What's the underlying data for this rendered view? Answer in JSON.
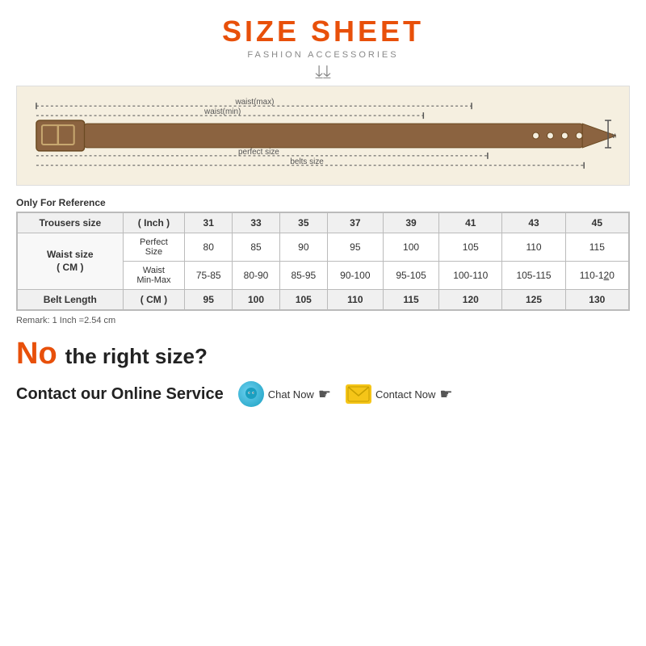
{
  "header": {
    "title": "SIZE SHEET",
    "subtitle": "FASHION ACCESSORIES",
    "chevron": "❯❯"
  },
  "belt_diagram": {
    "labels": {
      "waist_max": "waist(max)",
      "waist_min": "waist(min)",
      "perfect_size": "perfect size",
      "belts_size": "belts size",
      "width": "width"
    }
  },
  "only_ref": "Only For Reference",
  "table": {
    "col_headers": [
      "",
      "( Inch )",
      "31",
      "33",
      "35",
      "37",
      "39",
      "41",
      "43",
      "45"
    ],
    "waist_size_label": "Waist size\n( CM )",
    "perfect_size_label": "Perfect\nSize",
    "waist_min_max_label": "Waist\nMin-Max",
    "trousers_size_label": "Trousers size",
    "perfect_size_values": [
      "80",
      "85",
      "90",
      "95",
      "100",
      "105",
      "110",
      "115"
    ],
    "waist_min_max_values": [
      "75-85",
      "80-90",
      "85-95",
      "90-100",
      "95-105",
      "100-110",
      "105-115",
      "110-120"
    ],
    "belt_length_label": "Belt Length",
    "belt_length_unit": "( CM )",
    "belt_length_values": [
      "95",
      "100",
      "105",
      "110",
      "115",
      "120",
      "125",
      "130"
    ]
  },
  "remark": "Remark: 1 Inch =2.54 cm",
  "no_section": {
    "no_text": "No",
    "right_size_text": "the right size?",
    "contact_label": "Contact our Online Service",
    "chat_now": "Chat Now",
    "contact_now": "Contact Now"
  }
}
